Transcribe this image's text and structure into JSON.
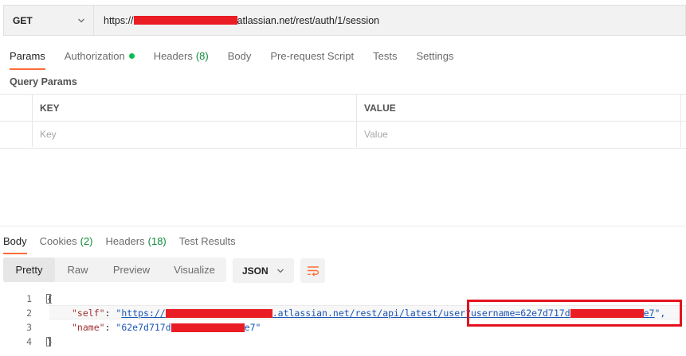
{
  "request": {
    "method": "GET",
    "url_prefix": "https://",
    "url_suffix": "atlassian.net/rest/auth/1/session"
  },
  "request_tabs": [
    {
      "label": "Params",
      "active": true
    },
    {
      "label": "Authorization",
      "indicator": "green-dot"
    },
    {
      "label": "Headers",
      "count": "(8)"
    },
    {
      "label": "Body"
    },
    {
      "label": "Pre-request Script"
    },
    {
      "label": "Tests"
    },
    {
      "label": "Settings"
    }
  ],
  "query_params": {
    "title": "Query Params",
    "headers": {
      "key": "KEY",
      "value": "VALUE"
    },
    "placeholders": {
      "key": "Key",
      "value": "Value"
    }
  },
  "response_tabs": [
    {
      "label": "Body",
      "active": true
    },
    {
      "label": "Cookies",
      "count": "(2)"
    },
    {
      "label": "Headers",
      "count": "(18)"
    },
    {
      "label": "Test Results"
    }
  ],
  "view_modes": [
    "Pretty",
    "Raw",
    "Preview",
    "Visualize"
  ],
  "active_view": "Pretty",
  "format": "JSON",
  "code": {
    "line_numbers": [
      "1",
      "2",
      "3",
      "4"
    ],
    "open_brace": "{",
    "close_brace": "}",
    "self_key": "\"self\"",
    "colon": ": ",
    "self_quote_open": "\"",
    "self_url_start": "https://",
    "self_url_mid": ".atlassian.net/rest/api/latest/use",
    "self_url_query": "r?username=62e7d717d",
    "self_url_end": "e7",
    "self_quote_close": "\",",
    "name_key": "\"name\"",
    "name_value_start": "\"62e7d717d",
    "name_value_end": "e7\""
  },
  "colors": {
    "accent": "#ff6c37",
    "redaction": "#ea1c24",
    "callout": "#e3121e",
    "status_green": "#0cbb52"
  }
}
